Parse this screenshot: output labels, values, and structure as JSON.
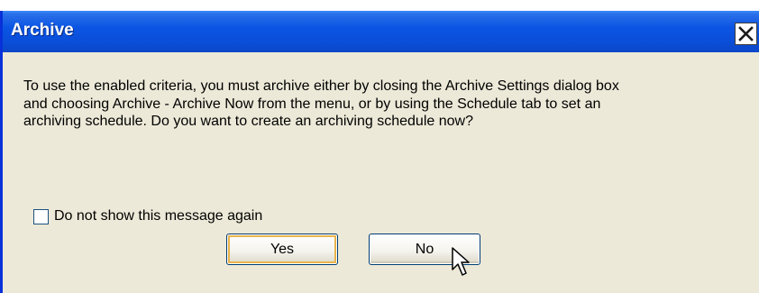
{
  "dialog": {
    "title": "Archive",
    "close_icon": "close-icon",
    "message": "To use the enabled criteria, you must archive either by closing the Archive Settings dialog box and choosing Archive - Archive Now from the menu, or by using the Schedule tab to set an archiving schedule. Do you want to create an archiving schedule now?",
    "checkbox": {
      "label": "Do not show this message again",
      "checked": false
    },
    "buttons": {
      "yes": "Yes",
      "no": "No"
    },
    "cursor_icon": "mouse-pointer-icon"
  },
  "colors": {
    "titlebar": "#0b55e4",
    "dialog_bg": "#ece9d8",
    "focus_ring": "#e9b44c",
    "button_border": "#003c74"
  }
}
